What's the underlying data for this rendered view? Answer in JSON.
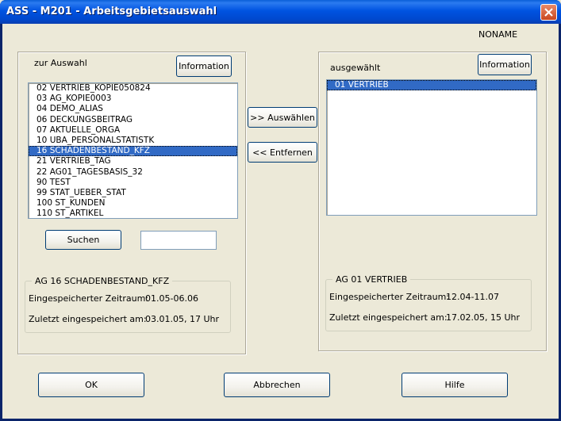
{
  "window": {
    "title": "ASS - M201 - Arbeitsgebietsauswahl",
    "noname": "NONAME"
  },
  "left": {
    "caption": "zur Auswahl",
    "info_label": "Information",
    "items": [
      "02  VERTRIEB_KOPIE050824",
      "03  AG_KOPIE0003",
      "04  DEMO_ALIAS",
      "06  DECKUNGSBEITRAG",
      "07  AKTUELLE_ORGA",
      "10  UBA_PERSONALSTATISTK",
      "16  SCHADENBESTAND_KFZ",
      "21  VERTRIEB_TAG",
      "22  AG01_TAGESBASIS_32",
      "90  TEST",
      "99  STAT_UEBER_STAT",
      "100 ST_KUNDEN",
      "110 ST_ARTIKEL"
    ],
    "selected_index": 6,
    "search_label": "Suchen",
    "search_value": "",
    "group": {
      "legend": "AG 16  SCHADENBESTAND_KFZ",
      "period_label": "Eingespeicherter Zeitraum:",
      "period_value": "01.05-06.06",
      "last_label": "Zuletzt eingespeichert am:",
      "last_value": "03.01.05, 17 Uhr"
    }
  },
  "middle": {
    "select_label": ">> Auswählen",
    "remove_label": "<< Entfernen"
  },
  "right": {
    "caption": "ausgewählt",
    "info_label": "Information",
    "items": [
      "01  VERTRIEB"
    ],
    "selected_index": 0,
    "group": {
      "legend": "AG 01  VERTRIEB",
      "period_label": "Eingespeicherter Zeitraum:",
      "period_value": "12.04-11.07",
      "last_label": "Zuletzt eingespeichert am:",
      "last_value": "17.02.05, 15 Uhr"
    }
  },
  "footer": {
    "ok_label": "OK",
    "cancel_label": "Abbrechen",
    "help_label": "Hilfe"
  },
  "colors": {
    "titlebar": "#0054E3",
    "selection": "#316AC5",
    "face": "#ECE9D8"
  }
}
